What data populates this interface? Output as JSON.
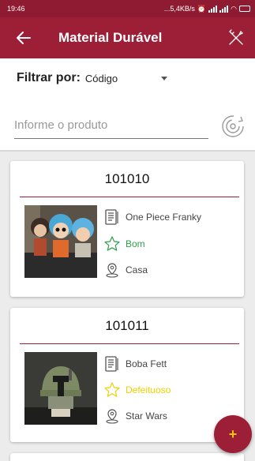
{
  "status": {
    "time": "19:46",
    "network": "...5,4KB/s"
  },
  "appbar": {
    "title": "Material Durável"
  },
  "filter": {
    "label": "Filtrar por:",
    "selected": "Código",
    "search_placeholder": "Informe o produto"
  },
  "items": [
    {
      "code": "101010",
      "name": "One Piece Franky",
      "condition": "Bom",
      "location": "Casa"
    },
    {
      "code": "101011",
      "name": "Boba Fett",
      "condition": "Defeituoso",
      "location": "Star Wars"
    }
  ],
  "colors": {
    "primary": "#9d1f37",
    "status_bar": "#8e1b32",
    "good": "#2e9e4a",
    "defective": "#f0d000",
    "fab_icon": "#f5c400"
  },
  "icons": {
    "back": "arrow-left-icon",
    "tools": "tools-icon",
    "refresh": "refresh-icon",
    "description": "document-icon",
    "condition": "star-icon",
    "location": "map-pin-icon",
    "add": "plus-icon"
  }
}
